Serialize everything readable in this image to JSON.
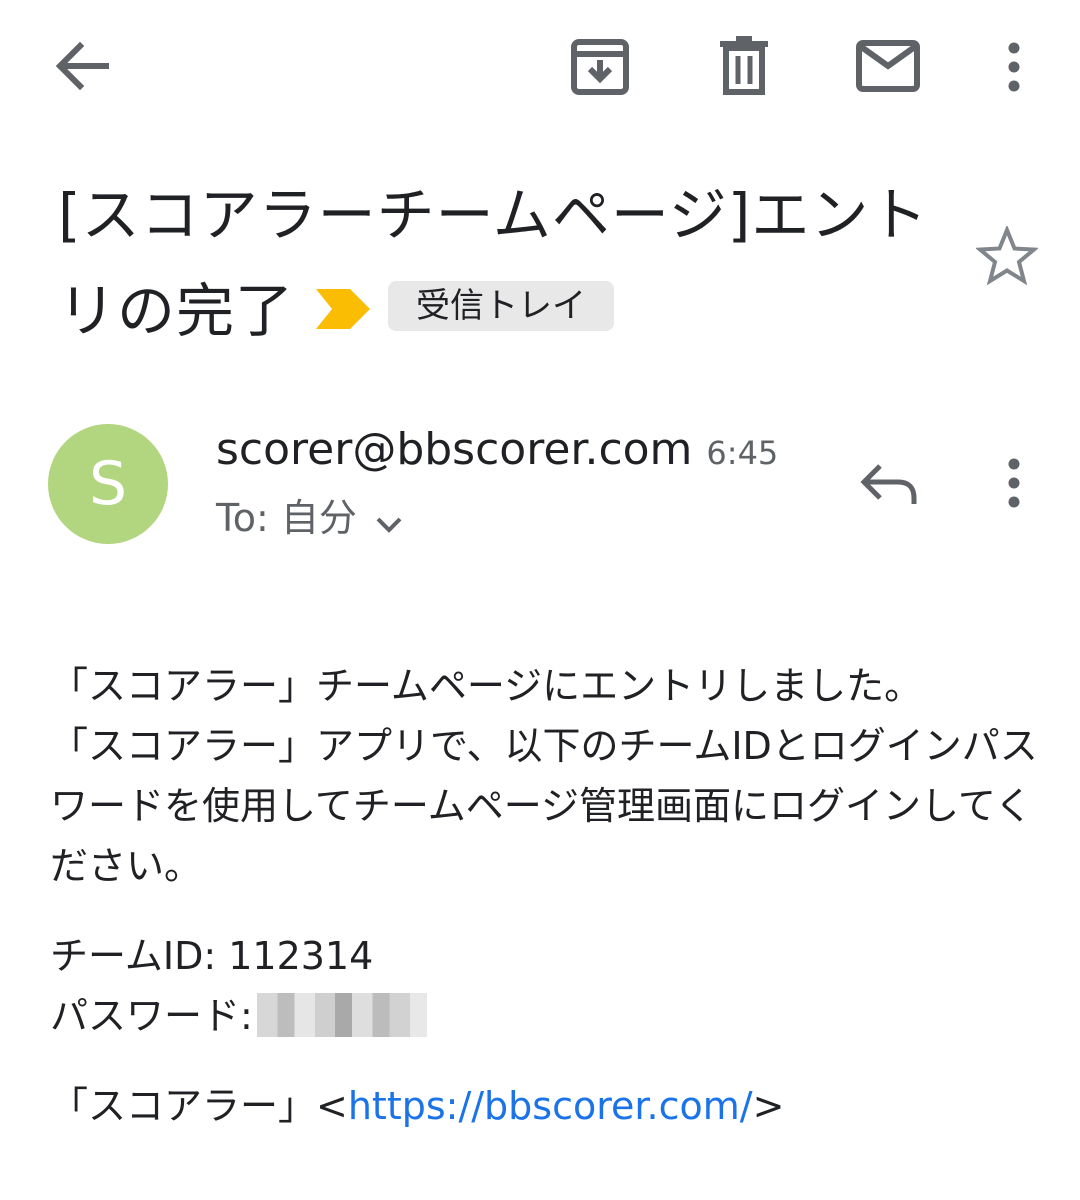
{
  "toolbar": {
    "back_icon": "arrow-back-icon",
    "archive_icon": "archive-icon",
    "delete_icon": "trash-icon",
    "mark_unread_icon": "mail-icon",
    "more_icon": "more-vert-icon"
  },
  "subject": {
    "text": "[スコアラーチームページ]エントリの完了",
    "label": "受信トレイ",
    "star_icon": "star-outline-icon",
    "importance_color": "#fbbc04"
  },
  "message": {
    "avatar_letter": "S",
    "avatar_color": "#b2d67f",
    "sender": "scorer@bbscorer.com",
    "time": "6:45",
    "to_line": "To: 自分",
    "reply_icon": "reply-icon",
    "more_icon": "more-vert-icon"
  },
  "body": {
    "line1": "「スコアラー」チームページにエントリしました。",
    "line2": "「スコアラー」アプリで、以下のチームIDとログインパスワードを使用してチームページ管理画面にログインしてください。",
    "team_id": "チームID: 112314",
    "password_label": "パスワード:",
    "signature_prefix": "「スコアラー」<",
    "signature_link": "https://bbscorer.com/",
    "signature_suffix": ">"
  }
}
